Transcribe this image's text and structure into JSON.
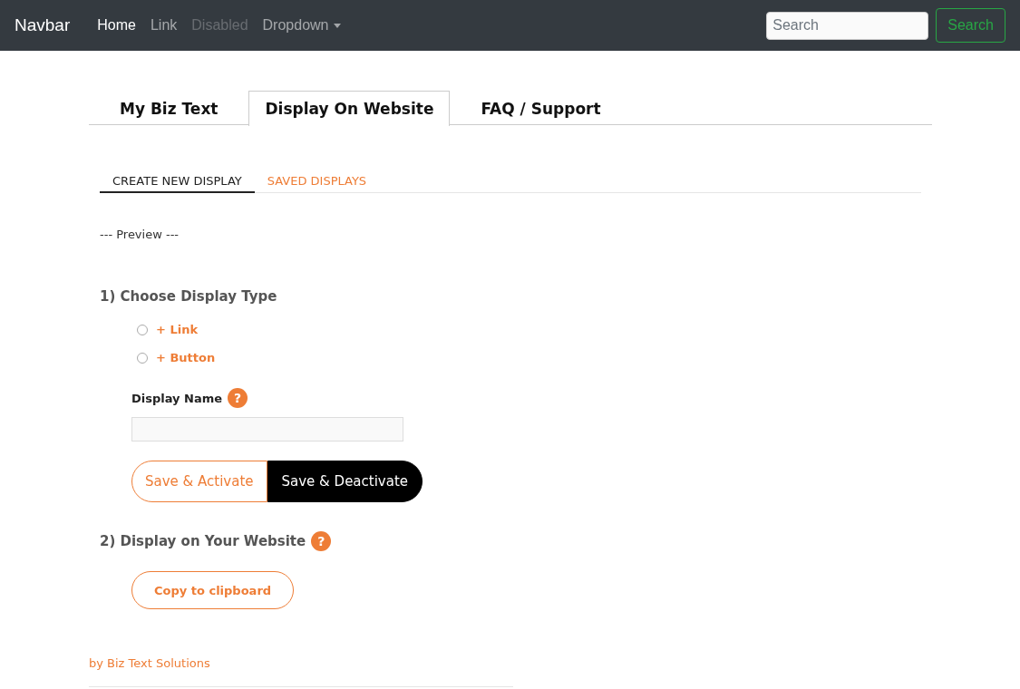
{
  "navbar": {
    "brand": "Navbar",
    "items": [
      {
        "label": "Home",
        "selected": true,
        "disabled": false,
        "dropdown": false
      },
      {
        "label": "Link",
        "selected": false,
        "disabled": false,
        "dropdown": false
      },
      {
        "label": "Disabled",
        "selected": false,
        "disabled": true,
        "dropdown": false
      },
      {
        "label": "Dropdown",
        "selected": false,
        "disabled": false,
        "dropdown": true
      }
    ],
    "search": {
      "placeholder": "Search",
      "button": "Search"
    }
  },
  "tabs": [
    {
      "label": "My Biz Text",
      "selected": false
    },
    {
      "label": "Display On Website",
      "selected": true
    },
    {
      "label": "FAQ / Support",
      "selected": false
    }
  ],
  "subtabs": [
    {
      "label": "CREATE NEW DISPLAY",
      "selected": true
    },
    {
      "label": "SAVED DISPLAYS",
      "selected": false
    }
  ],
  "preview": "--- Preview ---",
  "step1": {
    "heading": "1) Choose Display Type",
    "options": [
      {
        "label": "+ Link",
        "selected": false
      },
      {
        "label": "+ Button",
        "selected": false
      }
    ],
    "name_label": "Display Name",
    "help": "?",
    "buttons": [
      "Save & Activate",
      "Save & Deactivate"
    ]
  },
  "step2": {
    "heading": "2) Display on Your Website",
    "help": "?",
    "button": "Copy to clipboard"
  },
  "footer": "by Biz Text Solutions"
}
